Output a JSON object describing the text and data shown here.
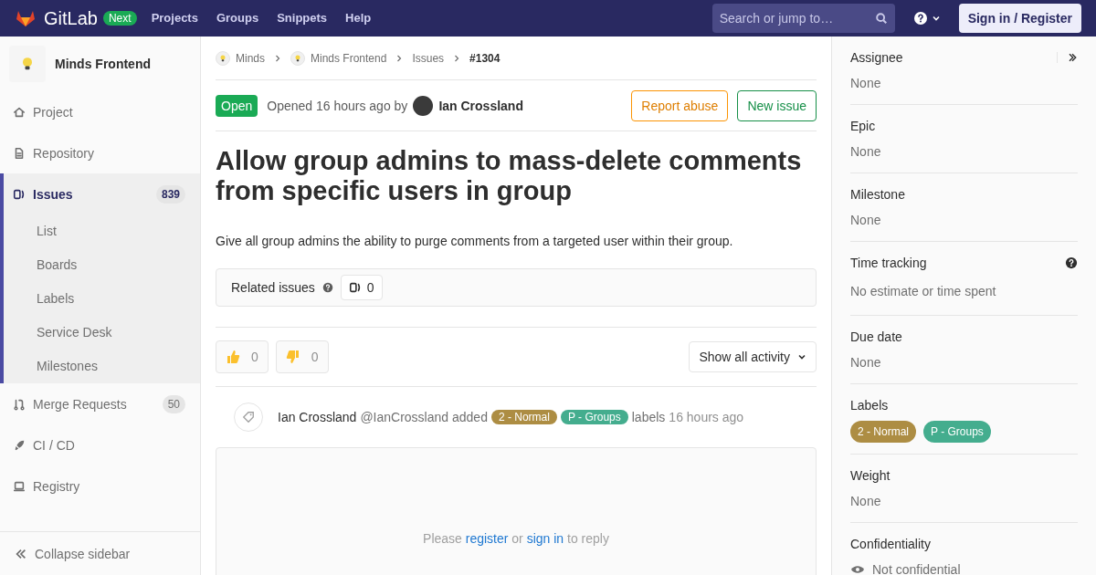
{
  "topbar": {
    "brand": "GitLab",
    "badge": "Next",
    "nav": [
      "Projects",
      "Groups",
      "Snippets",
      "Help"
    ],
    "search": {
      "placeholder": "Search or jump to…"
    },
    "signin": "Sign in / Register"
  },
  "sidebar": {
    "project": "Minds Frontend",
    "items": [
      {
        "label": "Project",
        "kind": "home",
        "selected": false
      },
      {
        "label": "Repository",
        "kind": "doc",
        "selected": false
      },
      {
        "label": "Issues",
        "kind": "issues",
        "count": "839",
        "selected": true,
        "children": [
          {
            "label": "List"
          },
          {
            "label": "Boards"
          },
          {
            "label": "Labels"
          },
          {
            "label": "Service Desk"
          },
          {
            "label": "Milestones"
          }
        ]
      },
      {
        "label": "Merge Requests",
        "kind": "merge",
        "count": "50",
        "selected": false
      },
      {
        "label": "CI / CD",
        "kind": "rocket",
        "selected": false
      },
      {
        "label": "Registry",
        "kind": "registry",
        "selected": false
      }
    ],
    "collapse": "Collapse sidebar"
  },
  "breadcrumbs": [
    {
      "label": "Minds",
      "avatar": true
    },
    {
      "label": "Minds Frontend",
      "avatar": true
    },
    {
      "label": "Issues",
      "avatar": false
    },
    {
      "label": "#1304",
      "avatar": false
    }
  ],
  "issue": {
    "status": "Open",
    "opened": "Opened 16 hours ago by",
    "author": "Ian Crossland",
    "actions": [
      {
        "label": "Report abuse",
        "kind": "warning"
      },
      {
        "label": "New issue",
        "kind": "success"
      }
    ],
    "title": "Allow group admins to mass-delete comments from specific users in group",
    "description": "Give all group admins the ability to purge comments from a targeted user within their group.",
    "related": {
      "label": "Related issues",
      "count": "0"
    },
    "reactions": [
      {
        "kind": "up",
        "count": "0"
      },
      {
        "kind": "down",
        "count": "0"
      }
    ],
    "activity_filter": "Show all activity",
    "note": {
      "author": "Ian Crossland",
      "handle": "@IanCrossland",
      "action": "added",
      "labels": [
        {
          "text": "2 - Normal",
          "color": "#ad8d43"
        },
        {
          "text": "P - Groups",
          "color": "#44ad8e"
        }
      ],
      "suffix": "labels",
      "time": "16 hours ago"
    },
    "reply": {
      "before": "Please",
      "register": "register",
      "or": "or",
      "signin": "sign in",
      "after": "to reply"
    }
  },
  "right_sidebar": [
    {
      "title": "Assignee",
      "value": "None",
      "kind": "text"
    },
    {
      "title": "Epic",
      "value": "None",
      "kind": "text"
    },
    {
      "title": "Milestone",
      "value": "None",
      "kind": "text"
    },
    {
      "title": "Time tracking",
      "value": "No estimate or time spent",
      "kind": "help"
    },
    {
      "title": "Due date",
      "value": "None",
      "kind": "text"
    },
    {
      "title": "Labels",
      "kind": "labels",
      "labels": [
        {
          "text": "2 - Normal",
          "color": "#ad8d43"
        },
        {
          "text": "P - Groups",
          "color": "#44ad8e"
        }
      ]
    },
    {
      "title": "Weight",
      "value": "None",
      "kind": "text"
    },
    {
      "title": "Confidentiality",
      "value": "Not confidential",
      "kind": "eye"
    }
  ]
}
